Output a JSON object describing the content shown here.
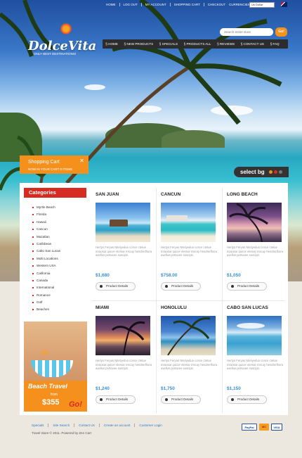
{
  "topnav": {
    "links": [
      "HOME",
      "LOG OUT",
      "MY ACCOUNT",
      "SHOPPING CART",
      "CHECKOUT"
    ],
    "currencies_label": "CURRENCIES:",
    "currency_selected": "Us Dollar"
  },
  "brand": {
    "name": "DolceVita",
    "tagline": "ONLY BEST DESTINATIONS!"
  },
  "search": {
    "placeholder": "Search entire store",
    "button": "Go!"
  },
  "mainnav": [
    "HOME",
    "NEW PRODUCTS",
    "SPECIALS",
    "PRODUCTS ALL",
    "REVIEWS",
    "CONTACT US",
    "FAQ"
  ],
  "cart": {
    "title": "Shopping Cart",
    "subtitle": "NOW IN YOUR CART 0 ITEMS",
    "close": "✕"
  },
  "select_bg": {
    "label": "select bg",
    "colors": [
      "#f0901c",
      "#d62b20",
      "#777777"
    ]
  },
  "categories": {
    "title": "Categories",
    "items": [
      "Myrtle Beach",
      "Florida",
      "Hawaii",
      "Cancun",
      "Mazatlan",
      "Caribbean",
      "Cabo San Lucas",
      "Multi Locations",
      "Western USA",
      "California",
      "Canada",
      "International",
      "Romance",
      "Golf",
      "Beaches"
    ]
  },
  "banner": {
    "title": "Beach Travel",
    "from": "from",
    "price": "$355",
    "cta": "Go!"
  },
  "product_desc": "Hertys Feryas Nitelyeduo conce ctetue mraosar quicer elemar mscuy hendrerlhora avellus portacee suscipit.",
  "product_button": "Product Details",
  "products": [
    {
      "name": "SAN JUAN",
      "price": "$1,680"
    },
    {
      "name": "CANCUN",
      "price": "$758.00"
    },
    {
      "name": "LONG BEACH",
      "price": "$1,050"
    },
    {
      "name": "MIAMI",
      "price": "$1,240"
    },
    {
      "name": "HONOLULU",
      "price": "$1,750"
    },
    {
      "name": "CABO SAN LUCAS",
      "price": "$1,150"
    }
  ],
  "footer": {
    "links": [
      "Specials",
      "Site Search",
      "Contact Us",
      "Create an account",
      "Customer Login"
    ],
    "copyright": "Travel Store © 2011. Powered by Zen Cart",
    "payments": [
      "PayPal",
      "MC",
      "VISA"
    ]
  },
  "colors": {
    "accent_orange": "#f5901c",
    "accent_red": "#d62b20",
    "price_blue": "#3a8fd3",
    "nav_dark": "#2c2c2c"
  }
}
